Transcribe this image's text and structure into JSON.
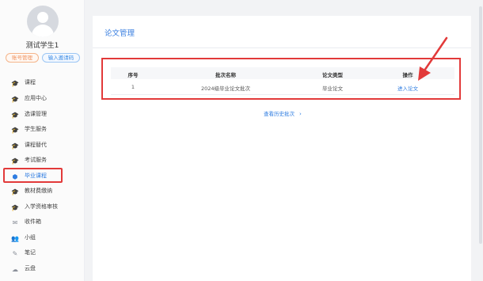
{
  "user": {
    "name": "测试学生1",
    "account_label": "账号管理",
    "invite_label": "输入邀请码"
  },
  "sidebar": {
    "items": [
      {
        "label": "课程",
        "icon": "graduation-cap-icon",
        "glyph": "🎓"
      },
      {
        "label": "应用中心",
        "icon": "graduation-cap-icon",
        "glyph": "🎓"
      },
      {
        "label": "选课管理",
        "icon": "graduation-cap-icon",
        "glyph": "🎓"
      },
      {
        "label": "学生服务",
        "icon": "graduation-cap-icon",
        "glyph": "🎓"
      },
      {
        "label": "课程替代",
        "icon": "graduation-cap-icon",
        "glyph": "🎓"
      },
      {
        "label": "考试服务",
        "icon": "graduation-cap-icon",
        "glyph": "🎓"
      },
      {
        "label": "毕业课程",
        "icon": "shield-icon",
        "glyph": "⬢",
        "active": true
      },
      {
        "label": "教材费缴纳",
        "icon": "graduation-cap-icon",
        "glyph": "🎓"
      },
      {
        "label": "入学资格审核",
        "icon": "graduation-cap-icon",
        "glyph": "🎓"
      },
      {
        "label": "收件箱",
        "icon": "mail-icon",
        "glyph": "✉"
      },
      {
        "label": "小组",
        "icon": "group-icon",
        "glyph": "👥"
      },
      {
        "label": "笔记",
        "icon": "pen-icon",
        "glyph": "✎"
      },
      {
        "label": "云盘",
        "icon": "cloud-icon",
        "glyph": "☁"
      }
    ]
  },
  "main": {
    "title": "论文管理",
    "table": {
      "headers": [
        "序号",
        "批次名称",
        "论文类型",
        "操作"
      ],
      "rows": [
        {
          "index": "1",
          "batch": "2024级毕业论文批次",
          "type": "毕业论文",
          "action": "进入论文"
        }
      ]
    },
    "history_link": "查看历史批次",
    "history_chevron": "›"
  },
  "colors": {
    "accent": "#2f7de1",
    "highlight": "#e23a3a",
    "account_pill": "#f0915d"
  }
}
